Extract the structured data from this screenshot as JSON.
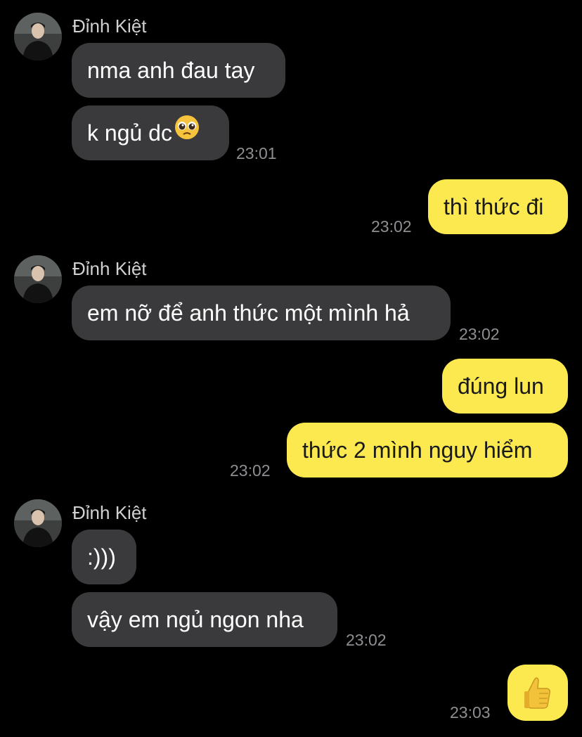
{
  "chat": {
    "contact_name": "Đỉnh Kiệt",
    "messages": [
      {
        "id": "m1",
        "from": "contact",
        "text": "nma anh đau tay"
      },
      {
        "id": "m2",
        "from": "contact",
        "text": "k ngủ dc",
        "emoji": "pleading-face",
        "time": "23:01"
      },
      {
        "id": "m3",
        "from": "me",
        "text": "thì thức đi",
        "time": "23:02"
      },
      {
        "id": "m4",
        "from": "contact",
        "text": "em nỡ để anh thức một mình hả",
        "time": "23:02"
      },
      {
        "id": "m5",
        "from": "me",
        "text": "đúng lun"
      },
      {
        "id": "m6",
        "from": "me",
        "text": "thức 2 mình nguy hiểm",
        "time": "23:02"
      },
      {
        "id": "m7",
        "from": "contact",
        "text": ":)))"
      },
      {
        "id": "m8",
        "from": "contact",
        "text": "vậy em ngủ ngon nha",
        "time": "23:02"
      },
      {
        "id": "m9",
        "from": "me",
        "emoji": "thumbs-up",
        "time": "23:03"
      }
    ]
  },
  "colors": {
    "background": "#000000",
    "received_bubble": "#3a3a3c",
    "sent_bubble": "#fce94f",
    "timestamp": "#8e8e93",
    "sender_name": "#d0d0d0"
  }
}
